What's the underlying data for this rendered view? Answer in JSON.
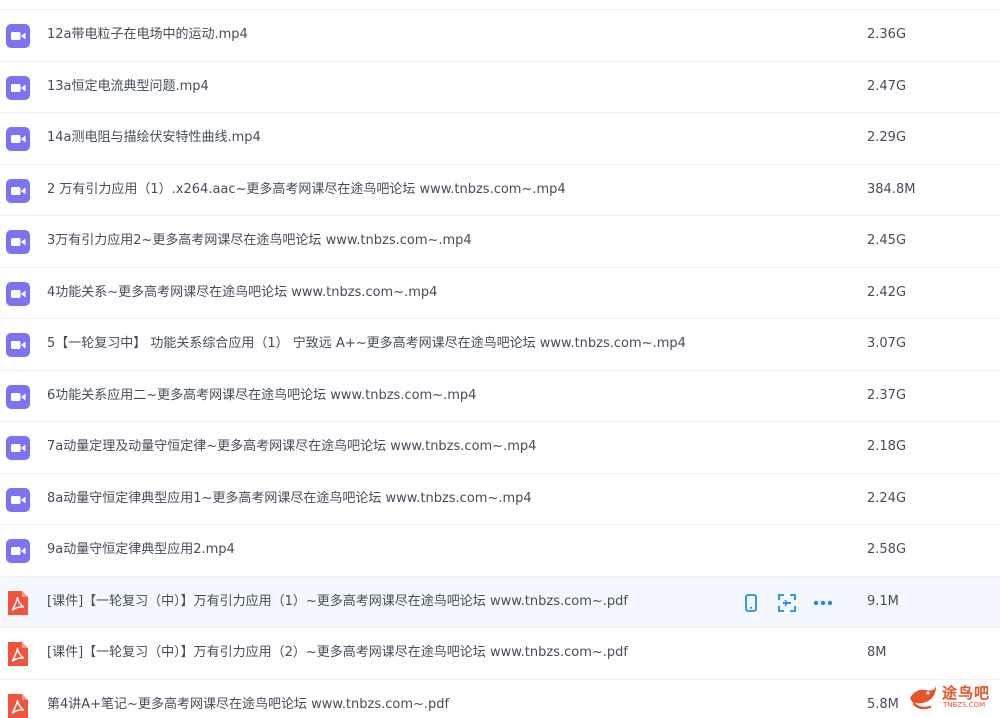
{
  "icons": {
    "video": "video-file-icon",
    "pdf": "pdf-file-icon"
  },
  "colors": {
    "video_icon": "#7b73f2",
    "pdf_icon": "#f0533e",
    "action_icon": "#1e8cf0",
    "row_hover": "#f3f8ff",
    "text": "#454d5a",
    "watermark": "#e8542a"
  },
  "files": [
    {
      "name": "12a带电粒子在电场中的运动.mp4",
      "size": "2.36G",
      "type": "video"
    },
    {
      "name": "13a恒定电流典型问题.mp4",
      "size": "2.47G",
      "type": "video"
    },
    {
      "name": "14a测电阻与描绘伏安特性曲线.mp4",
      "size": "2.29G",
      "type": "video"
    },
    {
      "name": "2 万有引力应用（1）.x264.aac~更多高考网课尽在途鸟吧论坛 www.tnbzs.com~.mp4",
      "size": "384.8M",
      "type": "video"
    },
    {
      "name": "3万有引力应用2~更多高考网课尽在途鸟吧论坛 www.tnbzs.com~.mp4",
      "size": "2.45G",
      "type": "video"
    },
    {
      "name": "4功能关系~更多高考网课尽在途鸟吧论坛 www.tnbzs.com~.mp4",
      "size": "2.42G",
      "type": "video"
    },
    {
      "name": "5【一轮复习中】 功能关系综合应用（1） 宁致远 A+~更多高考网课尽在途鸟吧论坛 www.tnbzs.com~.mp4",
      "size": "3.07G",
      "type": "video"
    },
    {
      "name": "6功能关系应用二~更多高考网课尽在途鸟吧论坛 www.tnbzs.com~.mp4",
      "size": "2.37G",
      "type": "video"
    },
    {
      "name": "7a动量定理及动量守恒定律~更多高考网课尽在途鸟吧论坛 www.tnbzs.com~.mp4",
      "size": "2.18G",
      "type": "video"
    },
    {
      "name": "8a动量守恒定律典型应用1~更多高考网课尽在途鸟吧论坛 www.tnbzs.com~.mp4",
      "size": "2.24G",
      "type": "video"
    },
    {
      "name": "9a动量守恒定律典型应用2.mp4",
      "size": "2.58G",
      "type": "video"
    },
    {
      "name": "[课件]【一轮复习（中）】万有引力应用（1）~更多高考网课尽在途鸟吧论坛 www.tnbzs.com~.pdf",
      "size": "9.1M",
      "type": "pdf",
      "hover": true
    },
    {
      "name": "[课件]【一轮复习（中）】万有引力应用（2）~更多高考网课尽在途鸟吧论坛 www.tnbzs.com~.pdf",
      "size": "8M",
      "type": "pdf"
    },
    {
      "name": "第4讲A+笔记~更多高考网课尽在途鸟吧论坛 www.tnbzs.com~.pdf",
      "size": "5.8M",
      "type": "pdf"
    }
  ],
  "row_actions": [
    {
      "name": "phone-icon"
    },
    {
      "name": "scan-icon"
    },
    {
      "name": "more-icon"
    }
  ],
  "watermark": {
    "text": "途鸟吧",
    "sub": "TNBZS.COM"
  }
}
